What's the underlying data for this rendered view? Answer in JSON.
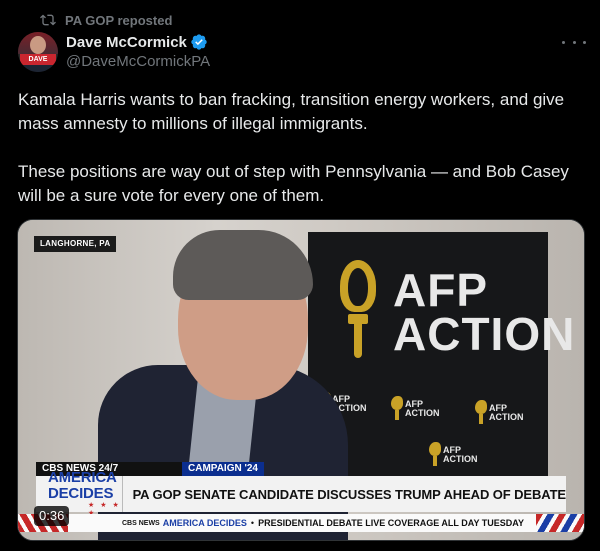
{
  "repost": {
    "icon": "repost-icon",
    "text": "PA GOP reposted"
  },
  "author": {
    "display_name": "Dave McCormick",
    "handle": "@DaveMcCormickPA",
    "verified_icon": "verified-badge-icon",
    "avatar_badge_text": "DAVE",
    "verified_color": "#1d9bf0"
  },
  "tweet": {
    "paragraph1": "Kamala Harris wants to ban fracking, transition energy workers, and give mass amnesty to millions of illegal immigrants.",
    "paragraph2": "These positions are way out of step with Pennsylvania — and Bob Casey will be a sure vote for every one of them."
  },
  "video": {
    "location_tag": "LANGHORNE, PA",
    "banner_big": [
      "AFP",
      "ACTION"
    ],
    "banner_small": [
      "AFP",
      "ACTION"
    ],
    "network_tag": "CBS NEWS 24/7",
    "campaign_tag": "CAMPAIGN '24",
    "show_title": "AMERICA DECIDES",
    "show_stars": "★ ★ ★ ★",
    "headline": "PA GOP SENATE CANDIDATE DISCUSSES TRUMP AHEAD OF DEBATE",
    "ticker_network": "CBS NEWS",
    "ticker_show": "AMERICA DECIDES",
    "ticker_dot": "•",
    "ticker_text": "PRESIDENTIAL DEBATE  LIVE COVERAGE ALL DAY TUESDAY",
    "duration": "0:36",
    "brand_color": "#1b3fa6",
    "accent_red": "#c62828",
    "torch_color": "#c9a227"
  }
}
